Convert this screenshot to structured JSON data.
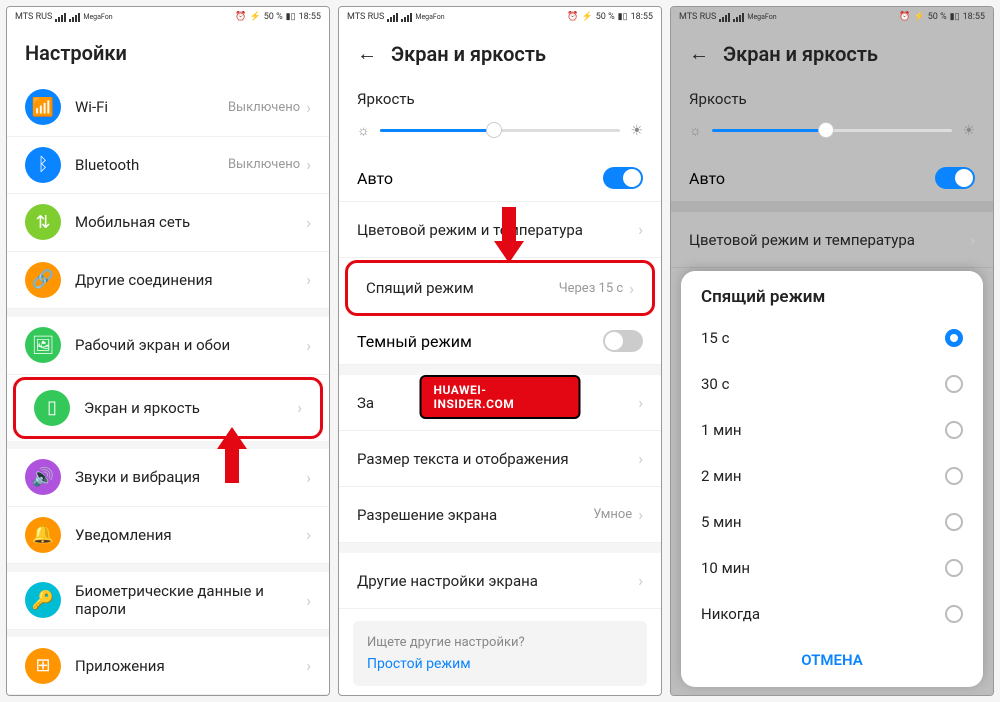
{
  "statusbar": {
    "carrier": "MTS RUS",
    "sub": "MegaFon",
    "battery": "50 %",
    "time": "18:55",
    "alarm": "⏰"
  },
  "screen1": {
    "title": "Настройки",
    "items": [
      {
        "label": "Wi-Fi",
        "value": "Выключено",
        "color": "#0a84ff",
        "icon": "wifi-icon"
      },
      {
        "label": "Bluetooth",
        "value": "Выключено",
        "color": "#0a84ff",
        "icon": "bluetooth-icon"
      },
      {
        "label": "Мобильная сеть",
        "value": "",
        "color": "#7fcd2e",
        "icon": "mobile-icon"
      },
      {
        "label": "Другие соединения",
        "value": "",
        "color": "#ff9500",
        "icon": "link-icon"
      },
      {
        "label": "Рабочий экран и обои",
        "value": "",
        "color": "#34c759",
        "icon": "wallpaper-icon"
      },
      {
        "label": "Экран и яркость",
        "value": "",
        "color": "#34c759",
        "icon": "display-icon",
        "highlighted": true
      },
      {
        "label": "Звуки и вибрация",
        "value": "",
        "color": "#af52de",
        "icon": "sound-icon"
      },
      {
        "label": "Уведомления",
        "value": "",
        "color": "#ff9500",
        "icon": "bell-icon"
      },
      {
        "label": "Биометрические данные и пароли",
        "value": "",
        "color": "#00bcd4",
        "icon": "key-icon"
      },
      {
        "label": "Приложения",
        "value": "",
        "color": "#ff9500",
        "icon": "apps-icon"
      }
    ]
  },
  "screen2": {
    "title": "Экран и яркость",
    "brightness_label": "Яркость",
    "auto_label": "Авто",
    "items": [
      {
        "label": "Цветовой режим и температура",
        "value": ""
      },
      {
        "label": "Спящий режим",
        "value": "Через 15 с",
        "highlighted": true
      },
      {
        "label": "Темный режим",
        "toggle": "off"
      },
      {
        "label": "За",
        "value": ""
      },
      {
        "label": "Размер текста и отображения",
        "value": ""
      },
      {
        "label": "Разрешение экрана",
        "value": "Умное"
      },
      {
        "label": "Другие настройки экрана",
        "value": ""
      }
    ],
    "hint_q": "Ищете другие настройки?",
    "hint_link": "Простой режим",
    "watermark": "HUAWEI-INSIDER.COM"
  },
  "screen3": {
    "title": "Экран и яркость",
    "brightness_label": "Яркость",
    "auto_label": "Авто",
    "color_mode": "Цветовой режим и температура",
    "modal_title": "Спящий режим",
    "options": [
      {
        "label": "15 с",
        "selected": true
      },
      {
        "label": "30 с",
        "selected": false
      },
      {
        "label": "1 мин",
        "selected": false
      },
      {
        "label": "2 мин",
        "selected": false
      },
      {
        "label": "5 мин",
        "selected": false
      },
      {
        "label": "10 мин",
        "selected": false
      },
      {
        "label": "Никогда",
        "selected": false
      }
    ],
    "cancel": "ОТМЕНА"
  }
}
